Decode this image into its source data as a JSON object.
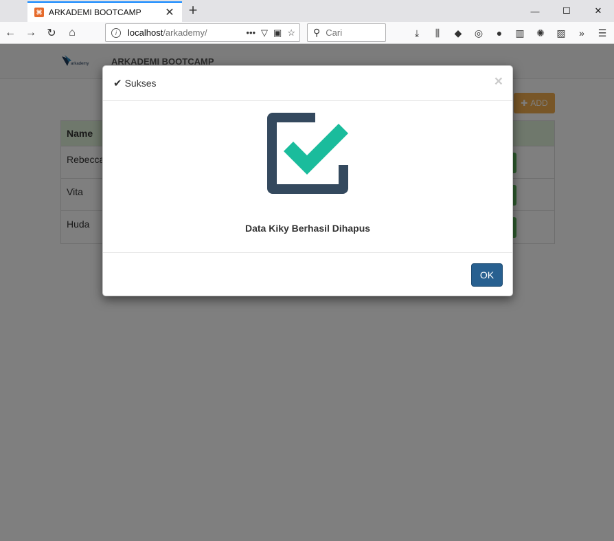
{
  "browser": {
    "tab_title": "ARKADEMI BOOTCAMP",
    "tab_favicon_icon": "xampp-icon",
    "url_host": "localhost",
    "url_path": "/arkademy/",
    "search_placeholder": "Cari"
  },
  "site": {
    "brand_title": "ARKADEMI BOOTCAMP",
    "logo_text": "arkademy",
    "add_label": "ADD",
    "table": {
      "header": "Name",
      "rows": [
        "Rebecca",
        "Vita",
        "Huda"
      ]
    }
  },
  "modal": {
    "title": "Sukses",
    "close_glyph": "×",
    "message": "Data Kiky Berhasil Dihapus",
    "ok_label": "OK",
    "icon_colors": {
      "box": "#34495e",
      "check": "#1abc9c"
    }
  },
  "colors": {
    "accent": "#0a84ff",
    "primary_button": "#286090",
    "warning_button": "#f0ad4e",
    "success_button": "#5cb85c",
    "table_header": "#dff0d8"
  }
}
